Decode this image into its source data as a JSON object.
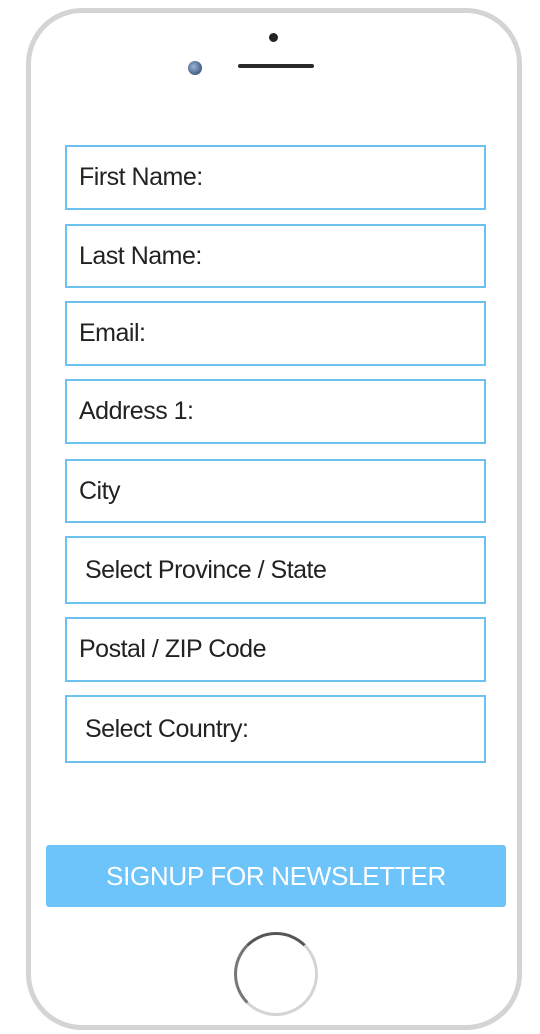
{
  "form": {
    "fields": [
      {
        "label": "First Name:"
      },
      {
        "label": "Last Name:"
      },
      {
        "label": "Email:"
      },
      {
        "label": "Address 1:"
      },
      {
        "label": "City"
      },
      {
        "label": "Select Province / State"
      },
      {
        "label": "Postal / ZIP Code"
      },
      {
        "label": "Select Country:"
      }
    ],
    "submit_label": "SIGNUP FOR NEWSLETTER"
  },
  "colors": {
    "accent": "#6cc4fb",
    "field_border": "#6cc1f0",
    "phone_frame": "#d4d4d4"
  }
}
